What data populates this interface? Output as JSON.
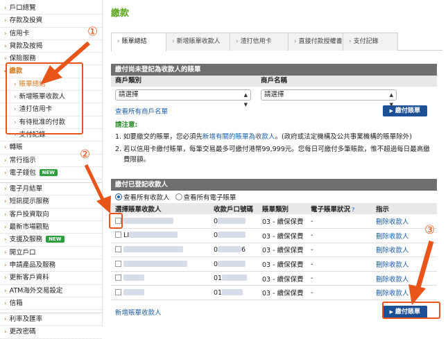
{
  "sidebar": {
    "group1": [
      {
        "label": "戶口總覽"
      },
      {
        "label": "存款及投資"
      },
      {
        "label": "信用卡"
      },
      {
        "label": "貸款及按揭"
      },
      {
        "label": "保險服務"
      }
    ],
    "payment": {
      "label": "繳款"
    },
    "payment_sub": [
      {
        "label": "賬單總結"
      },
      {
        "label": "新增賬單收款人"
      },
      {
        "label": "渣打信用卡"
      },
      {
        "label": "有待批准的付款"
      },
      {
        "label": "支付記錄"
      }
    ],
    "group2": [
      {
        "label": "轉賬"
      },
      {
        "label": "常行指示"
      },
      {
        "label": "電子錢包",
        "badge": "NEW"
      }
    ],
    "group3": [
      {
        "label": "電子月結單"
      },
      {
        "label": "短訊提示服務"
      },
      {
        "label": "客戶投資取向"
      },
      {
        "label": "最新市場觀點"
      },
      {
        "label": "支援及服務",
        "badge": "NEW"
      },
      {
        "label": "開立戶口"
      },
      {
        "label": "申請產品及服務"
      },
      {
        "label": "更新客戶資料"
      },
      {
        "label": "ATM海外交易設定"
      },
      {
        "label": "信箱"
      }
    ],
    "group4": [
      {
        "label": "利率及匯率"
      },
      {
        "label": "更改密碼"
      }
    ]
  },
  "annotations": {
    "one": "①",
    "two": "②",
    "three": "③"
  },
  "main": {
    "title": "繳款",
    "tabs": [
      {
        "label": "賬單總結"
      },
      {
        "label": "新增賬單收款人"
      },
      {
        "label": "渣打信用卡"
      },
      {
        "label": "直接付款授權書"
      },
      {
        "label": "支付記錄"
      }
    ],
    "panel1": {
      "heading": "繳付尚未登記為收款人的賬單",
      "col1": "商戶類別",
      "col2": "商戶名稱",
      "select1": "請選擇",
      "select2": "請選擇",
      "view_all_link": "查看所有商戶名單",
      "pay_button": "繳付賬單",
      "notice_title": "請注意:",
      "notice1_num": "1.",
      "notice1_pre": "如要繳交的賬單，您必須先",
      "notice1_link": "新增有關的賬單為收款人",
      "notice1_post": "。(政府或法定機構及公共事業機構的賬單除外)",
      "notice2_num": "2.",
      "notice2_line1": "若以信用卡繳付賬單，每筆交易最多可繳付港幣99,999元。您每日可繳付多筆賬款，惟不超過每日最高繳",
      "notice2_line2": "費限額。"
    },
    "panel2": {
      "heading": "繳付已登記收款人",
      "radio1": "查看所有收款人",
      "radio2": "查看所有電子賬單",
      "headers": [
        "選擇賬單收款人",
        "收款戶口號碼",
        "賬單類別",
        "電子賬單狀況",
        "指示"
      ],
      "rows": [
        {
          "name_prefix": "",
          "acct": "0",
          "type": "03 - 續保保費",
          "status": "-",
          "action": "刪除收款人"
        },
        {
          "name_prefix": "LI",
          "acct": "0",
          "type": "03 - 續保保費",
          "status": "-",
          "action": "刪除收款人"
        },
        {
          "name_prefix": "",
          "acct": "0",
          "acct_suffix": "6",
          "type": "03 - 續保保費",
          "status": "-",
          "action": "刪除收款人"
        },
        {
          "name_prefix": "",
          "acct": "0",
          "type": "03 - 續保保費",
          "status": "-",
          "action": "刪除收款人"
        },
        {
          "name_prefix": "",
          "acct": "01",
          "type": "03 - 續保保費",
          "status": "-",
          "action": "刪除收款人"
        },
        {
          "name_prefix": "",
          "acct": "01",
          "type": "03 - 續保保費",
          "status": "-",
          "action": "刪除收款人"
        }
      ],
      "add_link": "新增賬單收款人",
      "pay_button": "繳付賬單"
    }
  },
  "colors": {
    "accent_green": "#5aa51f",
    "annotation_orange": "#e8541a",
    "button_blue": "#1d4f96",
    "link_blue": "#1d5fa6"
  }
}
